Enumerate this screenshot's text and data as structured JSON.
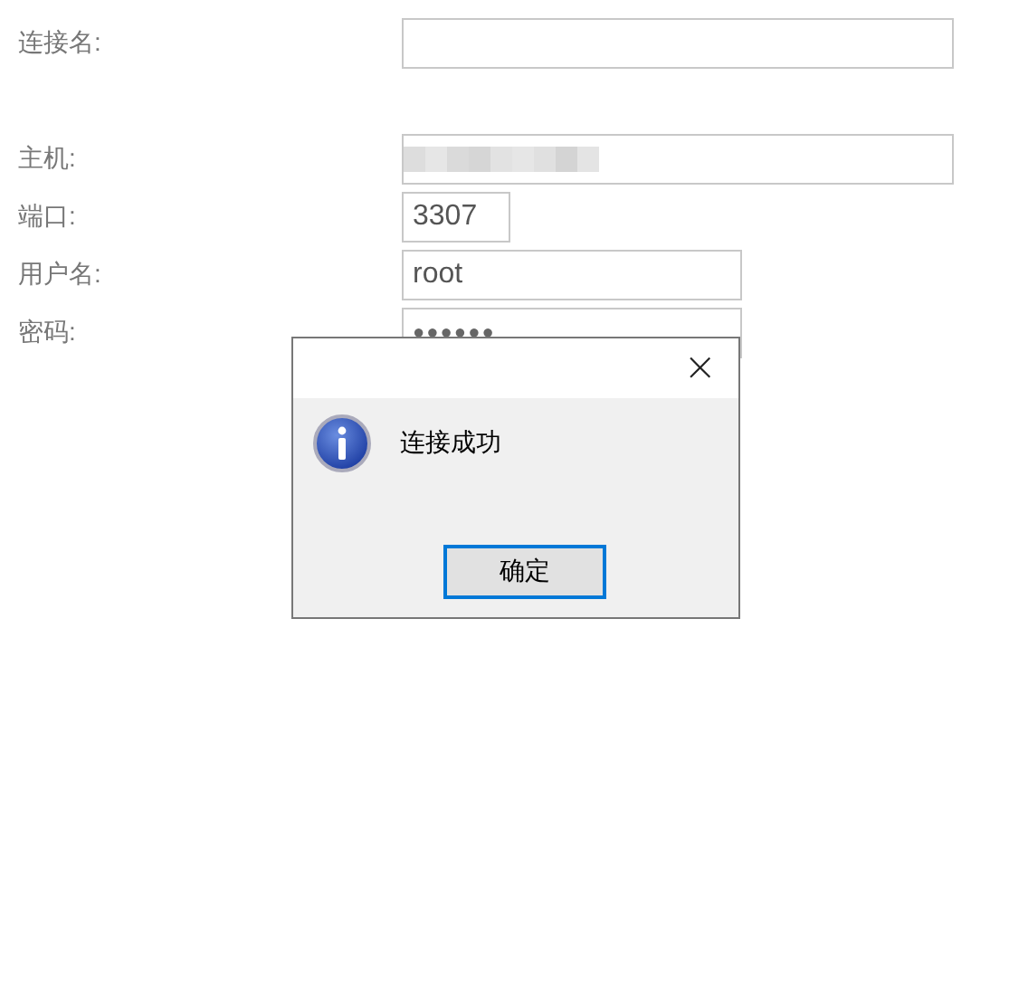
{
  "form": {
    "fields": [
      {
        "label": "连接名:",
        "kind": "text"
      },
      {
        "label": "主机:",
        "kind": "text",
        "blurred": true
      },
      {
        "label": "端口:",
        "value": "3307",
        "kind": "text"
      },
      {
        "label": "用户名:",
        "value": "root",
        "kind": "text"
      },
      {
        "label": "密码:",
        "value": "●●●●●●",
        "kind": "password"
      }
    ]
  },
  "dialog": {
    "close": "×",
    "message": "连接成功",
    "button": "确定"
  }
}
